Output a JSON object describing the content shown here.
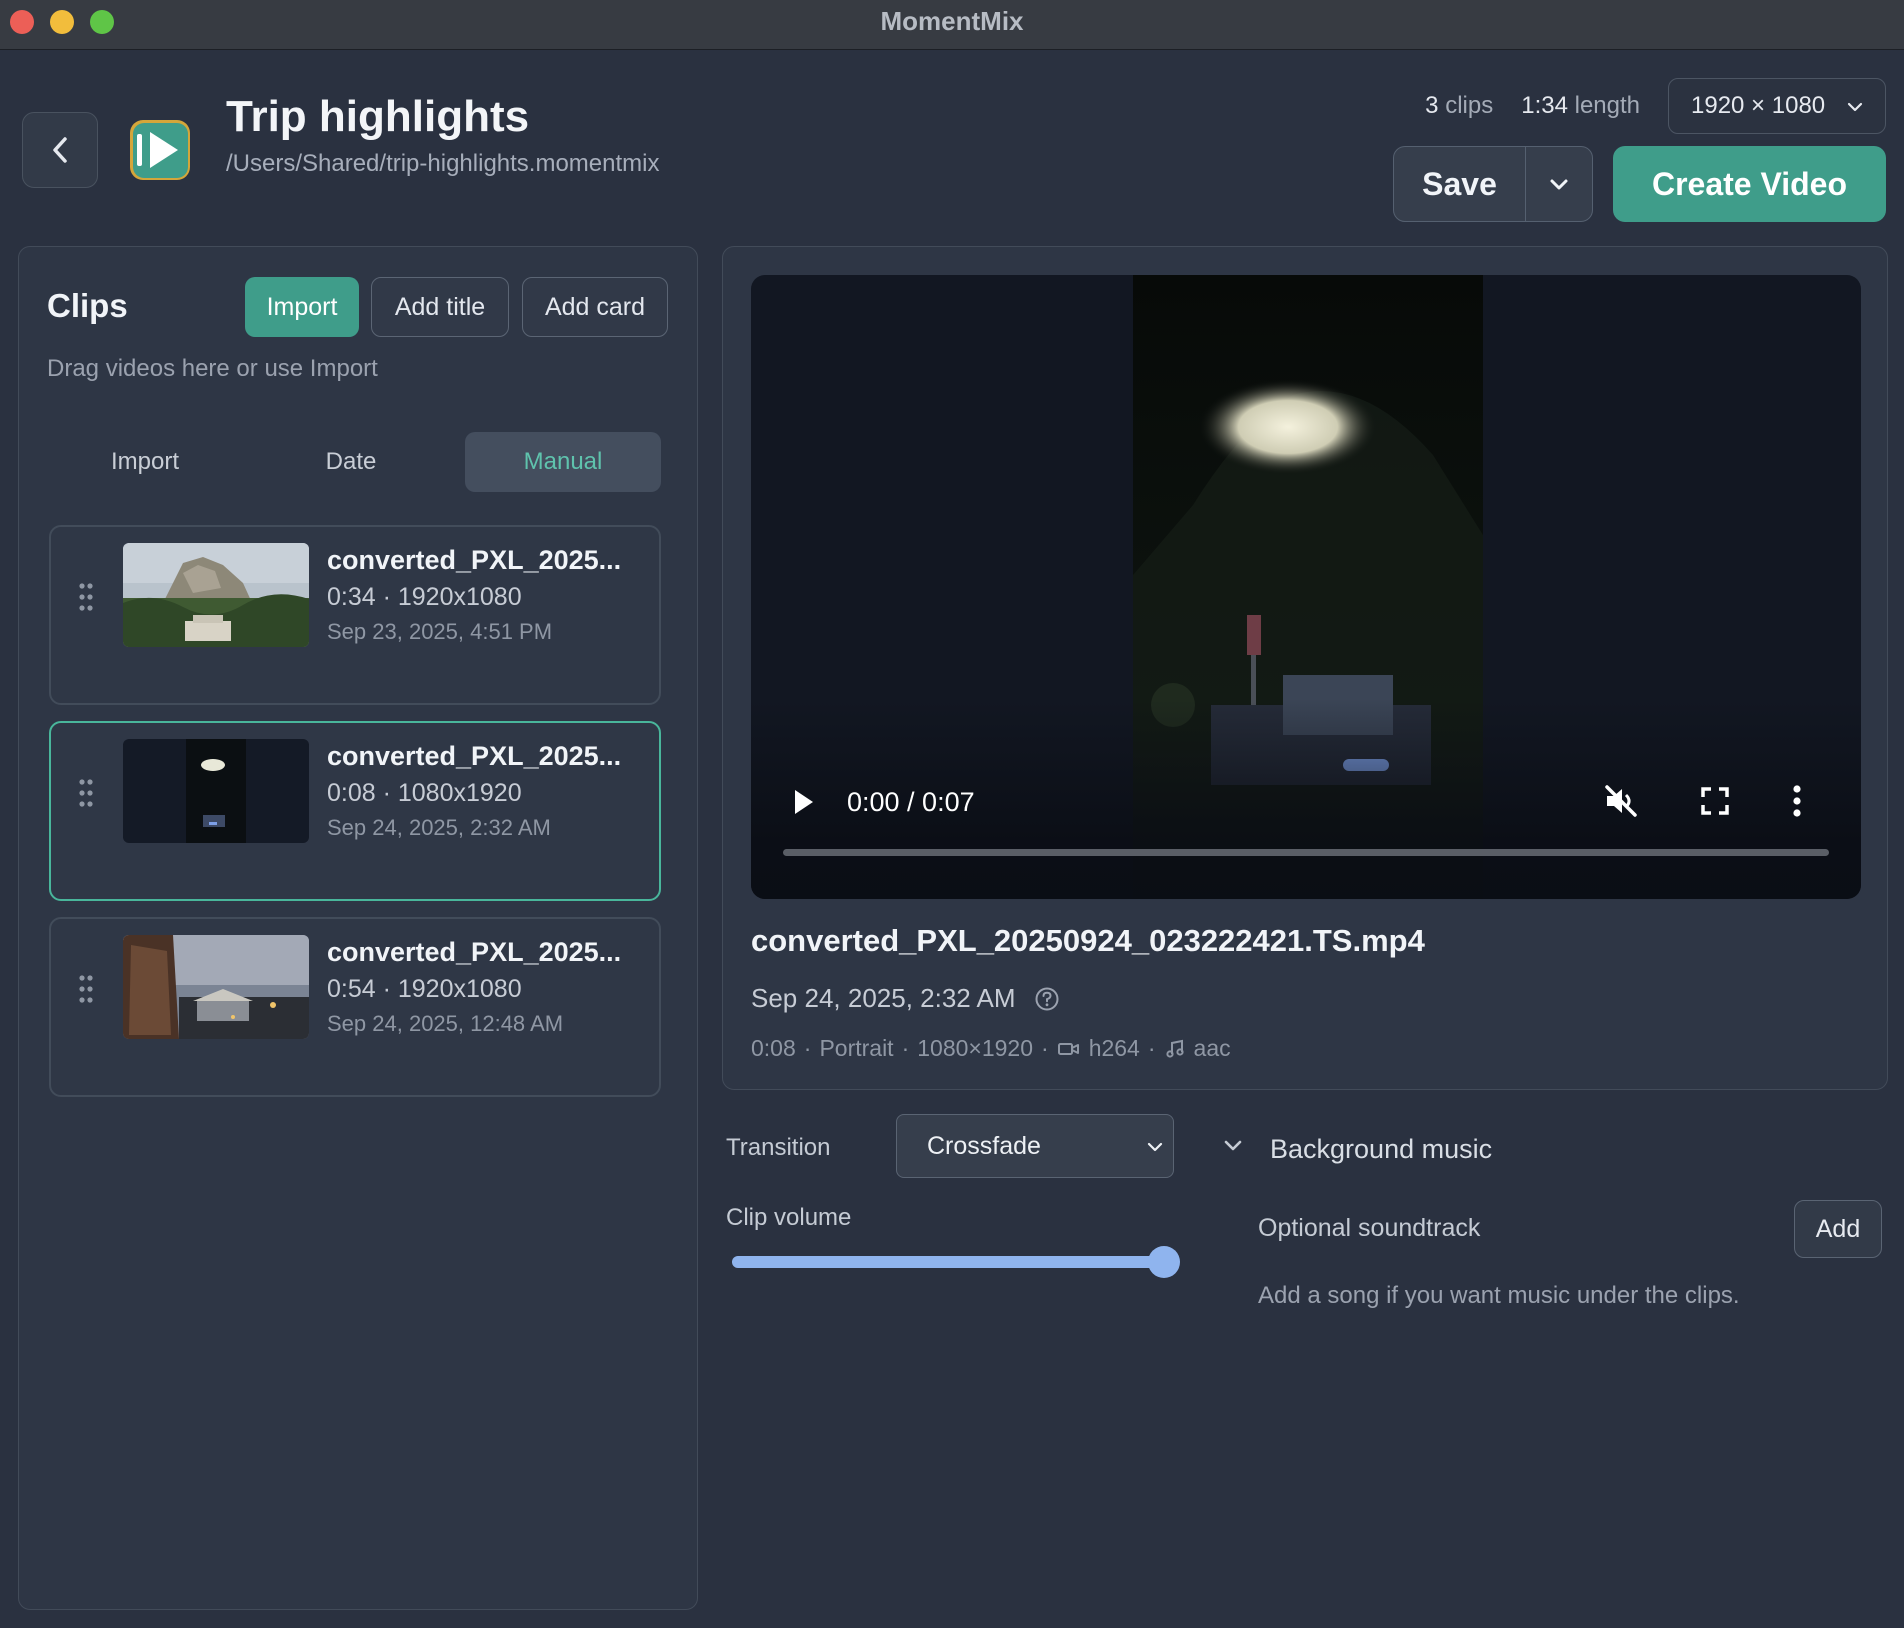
{
  "window": {
    "title": "MomentMix"
  },
  "header": {
    "project_title": "Trip highlights",
    "project_path": "/Users/Shared/trip-highlights.momentmix",
    "clip_count": "3",
    "clip_count_unit": "clips",
    "length": "1:34",
    "length_unit": "length",
    "resolution": "1920 × 1080",
    "save_label": "Save",
    "create_label": "Create Video"
  },
  "clips_panel": {
    "heading": "Clips",
    "import_label": "Import",
    "add_title_label": "Add title",
    "add_card_label": "Add card",
    "hint": "Drag videos here or use Import",
    "sort_tabs": [
      "Import",
      "Date",
      "Manual"
    ],
    "active_sort": "Manual",
    "clips": [
      {
        "name": "converted_PXL_2025...",
        "meta": "0:34 · 1920x1080",
        "date": "Sep 23, 2025, 4:51 PM",
        "selected": false
      },
      {
        "name": "converted_PXL_2025...",
        "meta": "0:08 · 1080x1920",
        "date": "Sep 24, 2025, 2:32 AM",
        "selected": true
      },
      {
        "name": "converted_PXL_2025...",
        "meta": "0:54 · 1920x1080",
        "date": "Sep 24, 2025, 12:48 AM",
        "selected": false
      }
    ]
  },
  "preview": {
    "time": "0:00 / 0:07",
    "progress": 0,
    "file_name": "converted_PXL_20250924_023222421.TS.mp4",
    "date": "Sep 24, 2025, 2:32 AM",
    "specs": {
      "duration": "0:08",
      "orientation": "Portrait",
      "dimensions": "1080×1920",
      "video_codec": "h264",
      "audio_codec": "aac"
    }
  },
  "controls": {
    "transition_label": "Transition",
    "transition_value": "Crossfade",
    "volume_label": "Clip volume",
    "volume": 1.0,
    "bg_music_title": "Background music",
    "soundtrack_label": "Optional soundtrack",
    "add_label": "Add",
    "soundtrack_hint": "Add a song if you want music under the clips."
  },
  "colors": {
    "accent": "#3f9d8a",
    "selected_border": "#49b69b",
    "slider": "#8fb4ee",
    "background": "#2a3140"
  },
  "icons": {
    "back": "chevron-left-icon",
    "logo": "play-logo-icon",
    "drag": "drag-handle-icon",
    "play": "play-icon",
    "mute": "mute-icon",
    "fullscreen": "fullscreen-icon",
    "more": "more-vertical-icon",
    "help": "help-circle-icon",
    "video": "video-camera-icon",
    "audio": "music-note-icon"
  }
}
